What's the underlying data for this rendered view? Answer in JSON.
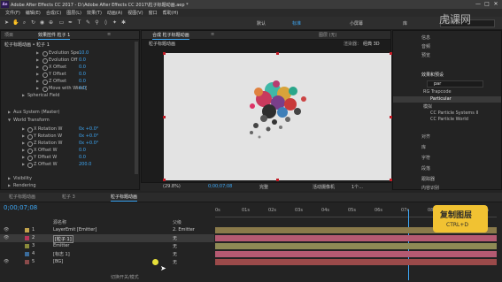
{
  "app": {
    "title": "Adobe After Effects CC 2017 - D:\\Adobe After Effects CC 2017\\粒子标题动画.aep *",
    "logo_text": "Ae",
    "window_controls": [
      "—",
      "□",
      "✕"
    ]
  },
  "menu": [
    "文件(F)",
    "编辑(E)",
    "合成(C)",
    "图层(L)",
    "效果(T)",
    "动画(A)",
    "视图(V)",
    "窗口",
    "帮助(H)"
  ],
  "toolbar": {
    "workspaces": [
      "默认",
      "标准",
      "小屏幕",
      "库"
    ],
    "active_workspace": "标准",
    "search_placeholder": "搜索帮助"
  },
  "effect_controls": {
    "tabs": [
      "项目",
      "效果控件 粒子 1",
      "≡"
    ],
    "header": "粒子标题动画 • 粒子 1",
    "rows": [
      {
        "label": "Evolution Spe",
        "value": "10.0"
      },
      {
        "label": "Evolution Off",
        "value": "0.0"
      },
      {
        "label": "X Offset",
        "value": "0.0"
      },
      {
        "label": "Y Offset",
        "value": "0.0"
      },
      {
        "label": "Z Offset",
        "value": "0.0"
      },
      {
        "label": "Move with Wind [",
        "value": "0.0"
      },
      {
        "label": "Spherical Field",
        "value": ""
      },
      {
        "label": "Aux System (Master)",
        "value": ""
      },
      {
        "label": "World Transform",
        "value": ""
      },
      {
        "label": "X Rotation W",
        "value": "0x +0.0°"
      },
      {
        "label": "Y Rotation W",
        "value": "0x +0.0°"
      },
      {
        "label": "Z Rotation W",
        "value": "0x +0.0°"
      },
      {
        "label": "X Offset W",
        "value": "0.0"
      },
      {
        "label": "Y Offset W",
        "value": "0.0"
      },
      {
        "label": "Z Offset W",
        "value": "200.0"
      },
      {
        "label": "Visibility",
        "value": ""
      },
      {
        "label": "Rendering",
        "value": ""
      }
    ]
  },
  "composition": {
    "tabs": [
      "合成 粒子标题动画",
      "≡",
      "图层 (无)"
    ],
    "subtab": "粒子标题动画",
    "zoom": "(29.8%)",
    "timecode": "0;00;07;08",
    "resolution": "完整",
    "camera": "活动摄像机",
    "views": "1个...",
    "render_label": "渲染器：",
    "render_value": "经典 3D"
  },
  "right_panel": {
    "items": [
      "信息",
      "音频",
      "预览"
    ],
    "section": "效果和预设",
    "search_value": "par",
    "group1": "RG Trapcode",
    "group1_item": "Particular",
    "group2": "模拟",
    "group2_items": [
      "CC Particle Systems II",
      "CC Particle World"
    ],
    "more_items": [
      "对齐",
      "库",
      "字符",
      "段落",
      "跟踪器",
      "内容识别"
    ]
  },
  "timeline": {
    "tabs": [
      "粒子标题动画",
      "粒子 3",
      "粒子标题动画"
    ],
    "timecode": "0;00;07;08",
    "col_header": "源名称",
    "parent_header": "父级",
    "layers": [
      {
        "num": "1",
        "name": "LayerEmit [Emitter]",
        "parent": "2. Emitter",
        "color": "#c2a34c"
      },
      {
        "num": "2",
        "name": "[粒子 1]",
        "parent": "无",
        "color": "#b8365a"
      },
      {
        "num": "3",
        "name": "Emitter",
        "parent": "无",
        "color": "#8a8a3a"
      },
      {
        "num": "4",
        "name": "[标志 1]",
        "parent": "无",
        "color": "#3a6b9a"
      },
      {
        "num": "5",
        "name": "[BG]",
        "parent": "无",
        "color": "#8a4a4a"
      }
    ],
    "ruler": [
      "0s",
      "01s",
      "02s",
      "03s",
      "04s",
      "05s",
      "06s",
      "07s",
      "08s",
      "09s",
      "10s"
    ],
    "bottom_label": "切换开关/模式"
  },
  "overlay": {
    "tip": "复制图层",
    "shortcut": "CTRL+D",
    "tip_color": "#f1c232"
  },
  "watermark": "虎课网"
}
